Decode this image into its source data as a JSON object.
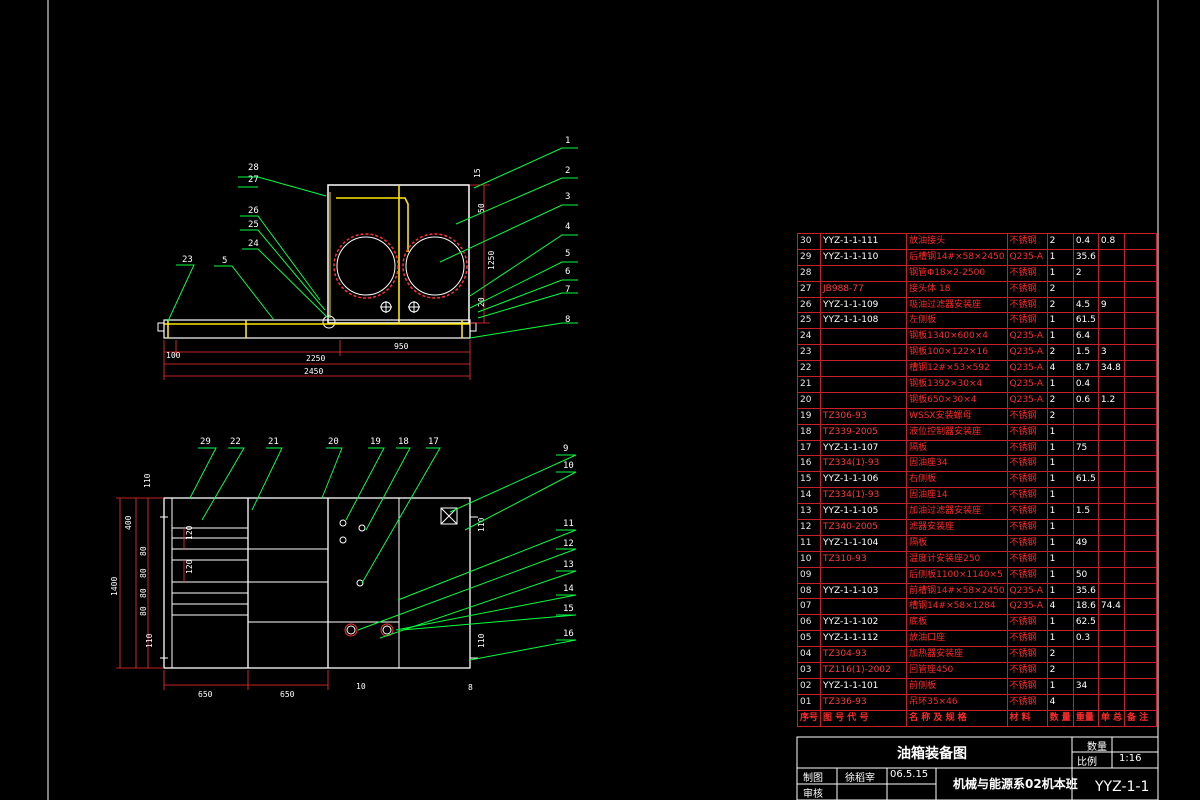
{
  "drawing": {
    "front_view": {
      "callouts": [
        "1",
        "2",
        "3",
        "4",
        "5",
        "6",
        "7",
        "8",
        "28",
        "27",
        "26",
        "25",
        "24",
        "23",
        "5"
      ],
      "dims": {
        "total": "2450",
        "inner": "2250",
        "base": "950",
        "left": "100",
        "height": "1250",
        "top": "15",
        "d50": "50",
        "d20": "20"
      }
    },
    "top_view": {
      "callouts": [
        "29",
        "22",
        "21",
        "20",
        "19",
        "18",
        "17",
        "9",
        "10",
        "11",
        "12",
        "13",
        "14",
        "15",
        "16"
      ],
      "dims": {
        "d650a": "650",
        "d650b": "650",
        "d1400": "1400",
        "d400": "400",
        "d110a": "110",
        "d110b": "110",
        "d120a": "120",
        "d120b": "120",
        "d80a": "80",
        "d80b": "80",
        "d80c": "80",
        "d80d": "80",
        "d110c": "110",
        "d110d": "110",
        "d10": "10",
        "d8": "8"
      }
    }
  },
  "bom": {
    "rows": [
      {
        "no": "30",
        "code": "YYZ-1-1-111",
        "red": false,
        "name": "放油接头",
        "mat": "不锈钢",
        "qty": "2",
        "w1": "0.4",
        "w2": "0.8"
      },
      {
        "no": "29",
        "code": "YYZ-1-1-110",
        "red": false,
        "name": "后槽钢14#×58×2450",
        "mat": "Q235-A",
        "qty": "1",
        "w1": "35.6",
        "w2": ""
      },
      {
        "no": "28",
        "code": "",
        "red": false,
        "name": "钢管Φ18×2-2500",
        "mat": "不锈钢",
        "qty": "1",
        "w1": "2",
        "w2": ""
      },
      {
        "no": "27",
        "code": "JB988-77",
        "red": true,
        "name": "接头体 18",
        "mat": "不锈钢",
        "qty": "2",
        "w1": "",
        "w2": ""
      },
      {
        "no": "26",
        "code": "YYZ-1-1-109",
        "red": false,
        "name": "吸油过滤器安装座",
        "mat": "不锈钢",
        "qty": "2",
        "w1": "4.5",
        "w2": "9"
      },
      {
        "no": "25",
        "code": "YYZ-1-1-108",
        "red": false,
        "name": "左侧板",
        "mat": "不锈钢",
        "qty": "1",
        "w1": "61.5",
        "w2": ""
      },
      {
        "no": "24",
        "code": "",
        "red": false,
        "name": "钢板1340×600×4",
        "mat": "Q235-A",
        "qty": "1",
        "w1": "6.4",
        "w2": ""
      },
      {
        "no": "23",
        "code": "",
        "red": false,
        "name": "钢板100×122×16",
        "mat": "Q235-A",
        "qty": "2",
        "w1": "1.5",
        "w2": "3"
      },
      {
        "no": "22",
        "code": "",
        "red": false,
        "name": "槽钢12#×53×592",
        "mat": "Q235-A",
        "qty": "4",
        "w1": "8.7",
        "w2": "34.8"
      },
      {
        "no": "21",
        "code": "",
        "red": false,
        "name": "钢板1392×30×4",
        "mat": "Q235-A",
        "qty": "1",
        "w1": "0.4",
        "w2": ""
      },
      {
        "no": "20",
        "code": "",
        "red": false,
        "name": "钢板650×30×4",
        "mat": "Q235-A",
        "qty": "2",
        "w1": "0.6",
        "w2": "1.2"
      },
      {
        "no": "19",
        "code": "TZ306-93",
        "red": true,
        "name": "WSSX安装螺母",
        "mat": "不锈钢",
        "qty": "2",
        "w1": "",
        "w2": ""
      },
      {
        "no": "18",
        "code": "TZ339-2005",
        "red": true,
        "name": "液位控制器安装座",
        "mat": "不锈钢",
        "qty": "1",
        "w1": "",
        "w2": ""
      },
      {
        "no": "17",
        "code": "YYZ-1-1-107",
        "red": false,
        "name": "隔板",
        "mat": "不锈钢",
        "qty": "1",
        "w1": "75",
        "w2": ""
      },
      {
        "no": "16",
        "code": "TZ334(1)-93",
        "red": true,
        "name": "固油座34",
        "mat": "不锈钢",
        "qty": "1",
        "w1": "",
        "w2": ""
      },
      {
        "no": "15",
        "code": "YYZ-1-1-106",
        "red": false,
        "name": "右侧板",
        "mat": "不锈钢",
        "qty": "1",
        "w1": "61.5",
        "w2": ""
      },
      {
        "no": "14",
        "code": "TZ334(1)-93",
        "red": true,
        "name": "固油座14",
        "mat": "不锈钢",
        "qty": "1",
        "w1": "",
        "w2": ""
      },
      {
        "no": "13",
        "code": "YYZ-1-1-105",
        "red": false,
        "name": "加油过滤器安装座",
        "mat": "不锈钢",
        "qty": "1",
        "w1": "1.5",
        "w2": ""
      },
      {
        "no": "12",
        "code": "TZ340-2005",
        "red": true,
        "name": "滤器安装座",
        "mat": "不锈钢",
        "qty": "1",
        "w1": "",
        "w2": ""
      },
      {
        "no": "11",
        "code": "YYZ-1-1-104",
        "red": false,
        "name": "隔板",
        "mat": "不锈钢",
        "qty": "1",
        "w1": "49",
        "w2": ""
      },
      {
        "no": "10",
        "code": "TZ310-93",
        "red": true,
        "name": "温度计安装座250",
        "mat": "不锈钢",
        "qty": "1",
        "w1": "",
        "w2": ""
      },
      {
        "no": "09",
        "code": "",
        "red": false,
        "name": "后侧板1100×1140×5",
        "mat": "不锈钢",
        "qty": "1",
        "w1": "50",
        "w2": ""
      },
      {
        "no": "08",
        "code": "YYZ-1-1-103",
        "red": false,
        "name": "前槽钢14#×58×2450",
        "mat": "Q235-A",
        "qty": "1",
        "w1": "35.6",
        "w2": ""
      },
      {
        "no": "07",
        "code": "",
        "red": false,
        "name": "槽钢14#×58×1284",
        "mat": "Q235-A",
        "qty": "4",
        "w1": "18.6",
        "w2": "74.4"
      },
      {
        "no": "06",
        "code": "YYZ-1-1-102",
        "red": false,
        "name": "底板",
        "mat": "不锈钢",
        "qty": "1",
        "w1": "62.5",
        "w2": ""
      },
      {
        "no": "05",
        "code": "YYZ-1-1-112",
        "red": false,
        "name": "放油口座",
        "mat": "不锈钢",
        "qty": "1",
        "w1": "0.3",
        "w2": ""
      },
      {
        "no": "04",
        "code": "TZ304-93",
        "red": true,
        "name": "加热器安装座",
        "mat": "不锈钢",
        "qty": "2",
        "w1": "",
        "w2": ""
      },
      {
        "no": "03",
        "code": "TZ116(1)-2002",
        "red": true,
        "name": "回管座450",
        "mat": "不锈钢",
        "qty": "2",
        "w1": "",
        "w2": ""
      },
      {
        "no": "02",
        "code": "YYZ-1-1-101",
        "red": false,
        "name": "前侧板",
        "mat": "不锈钢",
        "qty": "1",
        "w1": "34",
        "w2": ""
      },
      {
        "no": "01",
        "code": "TZ336-93",
        "red": true,
        "name": "吊环35×46",
        "mat": "不锈钢",
        "qty": "4",
        "w1": "",
        "w2": ""
      }
    ],
    "header": {
      "no": "序号",
      "code": "图 号 代 号",
      "name": "名 称 及 规 格",
      "mat": "材 料",
      "qty": "数 量",
      "w": "单 总",
      "wsub": "重量",
      "rem": "备 注"
    }
  },
  "title_block": {
    "drawing_title": "油箱装备图",
    "qty_label": "数量",
    "scale_label": "比例",
    "scale": "1:16",
    "draw_label": "制图",
    "drawer": "徐稻宰",
    "date": "06.5.15",
    "check_label": "审核",
    "org": "机械与能源系02机本班",
    "drawing_no": "YYZ-1-1"
  }
}
